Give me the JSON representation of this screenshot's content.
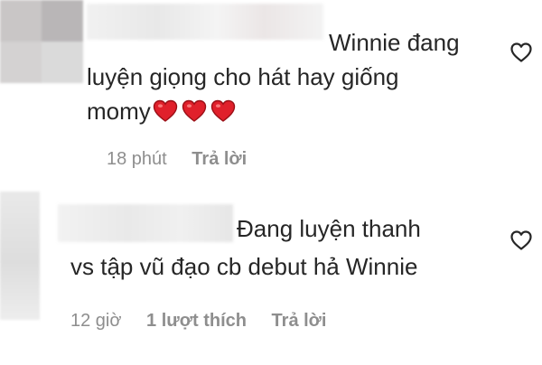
{
  "comments": [
    {
      "text_lines": [
        "Winnie đang",
        "luyện giọng cho hát hay giống",
        "momy"
      ],
      "emoji": [
        "red-heart",
        "red-heart",
        "red-heart"
      ],
      "time": "18 phút",
      "reply_label": "Trả lời"
    },
    {
      "text_lines": [
        "Đang luyện thanh",
        "vs tập vũ đạo cb debut hả Winnie"
      ],
      "time": "12 giờ",
      "likes_label": "1 lượt thích",
      "reply_label": "Trả lời"
    }
  ],
  "colors": {
    "text": "#262626",
    "meta": "#8e8e8e",
    "heart": "#e0202b",
    "icon_stroke": "#262626"
  },
  "icons": {
    "like": "heart-outline-icon"
  }
}
